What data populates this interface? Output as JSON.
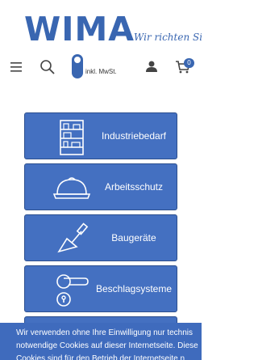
{
  "header": {
    "logo_text": "WIMA",
    "slogan": "Wir richten Sie e",
    "vat_label": "inkl. MwSt.",
    "cart_count": "0"
  },
  "icons": {
    "menu": "hamburger-menu-icon",
    "search": "search-icon",
    "vat_toggle": "toggle-switch",
    "user": "user-icon",
    "cart": "shopping-cart-icon"
  },
  "categories": [
    {
      "label": "Industriebedarf",
      "icon": "shelf-icon"
    },
    {
      "label": "Arbeitsschutz",
      "icon": "hard-hat-icon"
    },
    {
      "label": "Baugeräte",
      "icon": "trowel-icon"
    },
    {
      "label": "Beschlagsysteme",
      "icon": "door-handle-icon"
    },
    {
      "label": "",
      "icon": ""
    }
  ],
  "cookie_banner": {
    "line1": "Wir verwenden ohne Ihre Einwilligung nur technis",
    "line2": "notwendige Cookies auf dieser Internetseite. Diese",
    "line3": "Cookies sind für den Betrieb der Internetseite n"
  },
  "colors": {
    "brand": "#3966b1",
    "button": "#4470c1",
    "banner": "#3f6bbd"
  }
}
